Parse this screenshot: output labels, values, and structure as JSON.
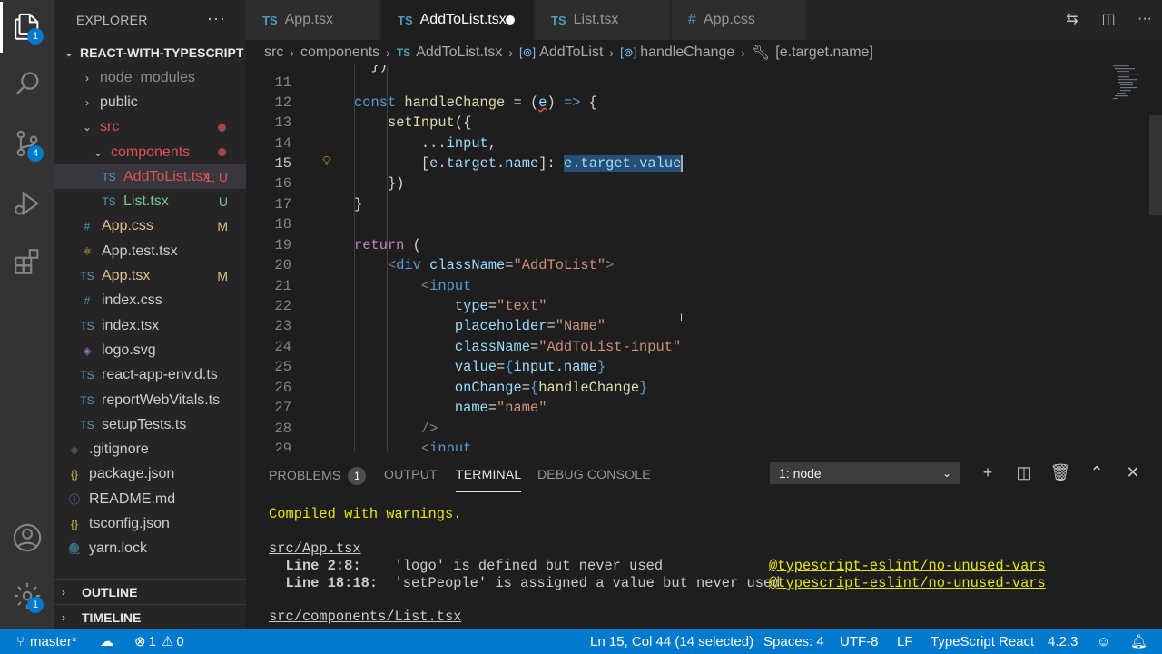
{
  "activity_bar": {
    "explorer_badge": "1",
    "scm_badge": "4",
    "settings_badge": "1"
  },
  "sidebar": {
    "title": "EXPLORER",
    "more": "···",
    "project": "REACT-WITH-TYPESCRIPT",
    "tree": [
      {
        "label": "node_modules",
        "color": "#8c8c8c"
      },
      {
        "label": "public",
        "color": "#cccccc"
      },
      {
        "label": "src",
        "color": "#e05252"
      },
      {
        "label": "components",
        "color": "#e05252"
      },
      {
        "label": "AddToList.tsx",
        "status": "1, U",
        "color": "#e05252"
      },
      {
        "label": "List.tsx",
        "status": "U",
        "color": "#73c991"
      },
      {
        "label": "App.css",
        "status": "M",
        "color": "#e2c08d"
      },
      {
        "label": "App.test.tsx",
        "color": "#cccccc"
      },
      {
        "label": "App.tsx",
        "status": "M",
        "color": "#e2c08d"
      },
      {
        "label": "index.css",
        "color": "#cccccc"
      },
      {
        "label": "index.tsx",
        "color": "#cccccc"
      },
      {
        "label": "logo.svg",
        "color": "#cccccc"
      },
      {
        "label": "react-app-env.d.ts",
        "color": "#cccccc"
      },
      {
        "label": "reportWebVitals.ts",
        "color": "#cccccc"
      },
      {
        "label": "setupTests.ts",
        "color": "#cccccc"
      },
      {
        "label": ".gitignore",
        "color": "#cccccc"
      },
      {
        "label": "package.json",
        "color": "#cccccc"
      },
      {
        "label": "README.md",
        "color": "#cccccc"
      },
      {
        "label": "tsconfig.json",
        "color": "#cccccc"
      },
      {
        "label": "yarn.lock",
        "color": "#cccccc"
      }
    ],
    "outline": "OUTLINE",
    "timeline": "TIMELINE"
  },
  "tabs": [
    {
      "label": "App.tsx",
      "icon": "TS"
    },
    {
      "label": "AddToList.tsx",
      "icon": "TS"
    },
    {
      "label": "List.tsx",
      "icon": "TS"
    },
    {
      "label": "App.css",
      "icon": "#"
    }
  ],
  "breadcrumb": [
    "src",
    "components",
    "AddToList.tsx",
    "AddToList",
    "handleChange",
    "[e.target.name]"
  ],
  "editor": {
    "line_numbers": [
      "11",
      "12",
      "13",
      "14",
      "15",
      "16",
      "17",
      "18",
      "19",
      "20",
      "21",
      "22",
      "23",
      "24",
      "25",
      "26",
      "27",
      "28",
      "29"
    ]
  },
  "panel": {
    "tabs": [
      "PROBLEMS",
      "OUTPUT",
      "TERMINAL",
      "DEBUG CONSOLE"
    ],
    "problems_count": "1",
    "terminal_select": "1: node",
    "lines": {
      "compiled": "Compiled with warnings.",
      "file1": "src/App.tsx",
      "w1_loc": "  Line 2:8:",
      "w1_msg": "    'logo' is defined but never used",
      "w1_rule": "@typescript-eslint/no-unused-vars",
      "w2_loc": "  Line 18:18:",
      "w2_msg": "  'setPeople' is assigned a value but never used",
      "w2_rule": "@typescript-eslint/no-unused-vars",
      "file2": "src/components/List.tsx"
    }
  },
  "statusbar": {
    "branch": "master*",
    "errors": "1",
    "warnings": "0",
    "position": "Ln 15, Col 44 (14 selected)",
    "spaces": "Spaces: 4",
    "encoding": "UTF-8",
    "eol": "LF",
    "language": "TypeScript React",
    "version": "4.2.3"
  }
}
